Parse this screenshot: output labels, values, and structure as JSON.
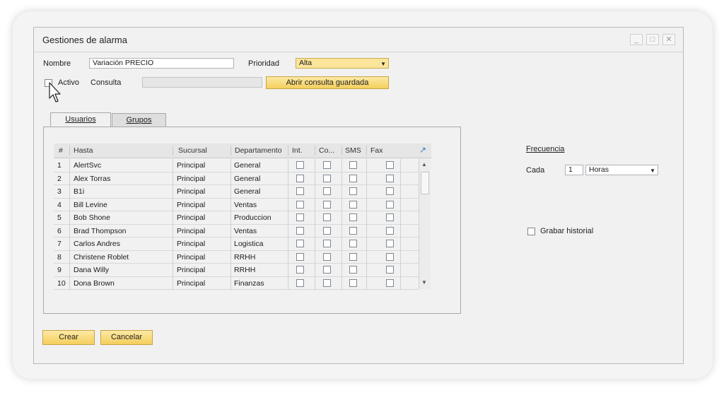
{
  "window": {
    "title": "Gestiones de alarma",
    "minimize": "_",
    "maximize": "□",
    "close": "✕"
  },
  "form": {
    "nombre_label": "Nombre",
    "nombre_value": "Variación PRECIO",
    "prioridad_label": "Prioridad",
    "prioridad_value": "Alta",
    "activo_label": "Activo",
    "consulta_label": "Consulta",
    "abrir_button": "Abrir consulta guardada"
  },
  "tabs": [
    {
      "label": "Usuarios"
    },
    {
      "label": "Grupos"
    }
  ],
  "grid": {
    "headers": {
      "num": "#",
      "hasta": "Hasta",
      "sucursal": "Sucursal",
      "departamento": "Departamento",
      "int": "Int.",
      "co": "Co...",
      "sms": "SMS",
      "fax": "Fax"
    },
    "rows": [
      {
        "num": "1",
        "hasta": "AlertSvc",
        "sucursal": "Principal",
        "departamento": "General"
      },
      {
        "num": "2",
        "hasta": "Alex Torras",
        "sucursal": "Principal",
        "departamento": "General"
      },
      {
        "num": "3",
        "hasta": "B1i",
        "sucursal": "Principal",
        "departamento": "General"
      },
      {
        "num": "4",
        "hasta": "Bill Levine",
        "sucursal": "Principal",
        "departamento": "Ventas"
      },
      {
        "num": "5",
        "hasta": "Bob Shone",
        "sucursal": "Principal",
        "departamento": "Produccion"
      },
      {
        "num": "6",
        "hasta": "Brad Thompson",
        "sucursal": "Principal",
        "departamento": "Ventas"
      },
      {
        "num": "7",
        "hasta": "Carlos Andres",
        "sucursal": "Principal",
        "departamento": "Logistica"
      },
      {
        "num": "8",
        "hasta": "Christene Roblet",
        "sucursal": "Principal",
        "departamento": "RRHH"
      },
      {
        "num": "9",
        "hasta": "Dana Willy",
        "sucursal": "Principal",
        "departamento": "RRHH"
      },
      {
        "num": "10",
        "hasta": "Dona Brown",
        "sucursal": "Principal",
        "departamento": "Finanzas"
      }
    ]
  },
  "frecuencia": {
    "title": "Frecuencia",
    "cada_label": "Cada",
    "cada_value": "1",
    "unidad_value": "Horas"
  },
  "historial_label": "Grabar historial",
  "footer": {
    "crear_button": "Crear",
    "cancelar_button": "Cancelar"
  },
  "icons": {
    "dropdown": "triangle-down-icon",
    "expand": "expand-arrow-icon",
    "cursor": "mouse-pointer-icon"
  },
  "colors": {
    "accent_yellow": "#f4cf5c",
    "link_blue": "#3a78c8"
  }
}
